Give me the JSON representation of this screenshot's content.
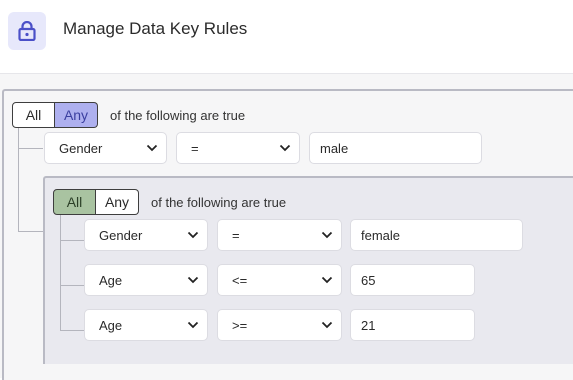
{
  "header": {
    "title": "Manage Data Key Rules",
    "icon": "lock-icon",
    "accent": "#4b50c8"
  },
  "outer_group": {
    "toggle": {
      "all_label": "All",
      "any_label": "Any",
      "selected": "Any"
    },
    "caption": "of the following are true",
    "rules": [
      {
        "field": "Gender",
        "operator": "=",
        "value": "male"
      }
    ]
  },
  "inner_group": {
    "toggle": {
      "all_label": "All",
      "any_label": "Any",
      "selected": "All"
    },
    "caption": "of the following are true",
    "rules": [
      {
        "field": "Gender",
        "operator": "=",
        "value": "female"
      },
      {
        "field": "Age",
        "operator": "<=",
        "value": "65"
      },
      {
        "field": "Age",
        "operator": ">=",
        "value": "21"
      }
    ]
  }
}
